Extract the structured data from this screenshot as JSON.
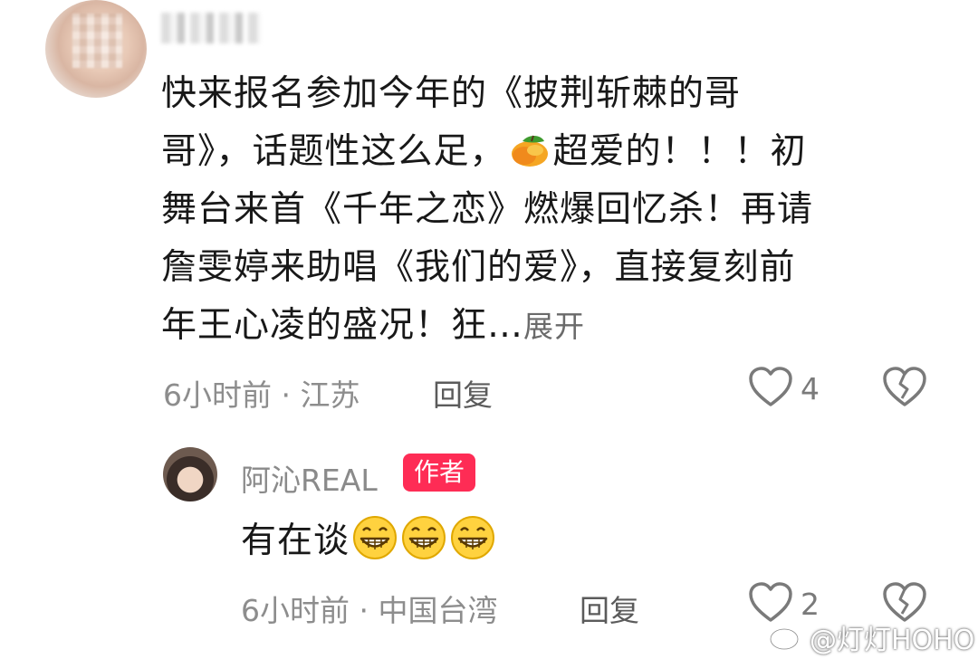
{
  "comment": {
    "line1": "快来报名参加今年的《披荆斩棘的哥",
    "line2_a": "哥》，话题性这么足，",
    "line2_b": "超爱的！！！初",
    "line3": "舞台来首《千年之恋》燃爆回忆杀！再请",
    "line4": "詹雯婷来助唱《我们的爱》，直接复刻前",
    "line5": "年王心凌的盛况！狂…",
    "expand_label": "展开",
    "time": "6小时前",
    "separator": "·",
    "location": "江苏",
    "reply_label": "回复",
    "likes": "4",
    "mango_icon": "mango-emoji-icon"
  },
  "reply": {
    "username": "阿沁REAL",
    "badge": "作者",
    "text": "有在谈",
    "emoji_icon": "grinning-face-icon",
    "time": "6小时前",
    "separator": "·",
    "location": "中国台湾",
    "reply_label": "回复",
    "likes": "2"
  },
  "watermark": {
    "text": "@灯灯HOHO",
    "icon": "weibo-logo-icon"
  },
  "colors": {
    "badge": "#fe2c55",
    "meta_text": "#8d8d8d",
    "body_text": "#181818"
  }
}
